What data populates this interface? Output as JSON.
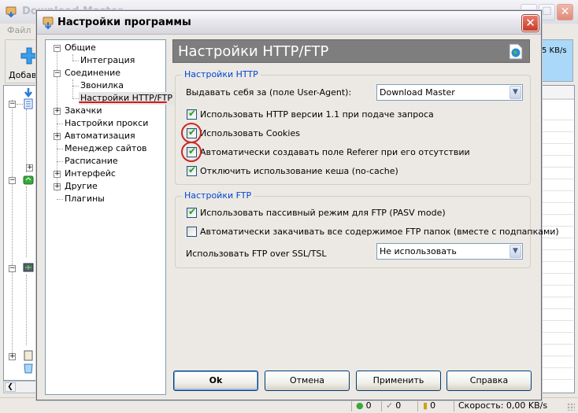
{
  "background_window": {
    "title": "Download Master",
    "menu": [
      "Файл"
    ],
    "toolbar": {
      "add_label": "Добавить"
    },
    "speed_box_text": "5 KB/s",
    "statusbar": {
      "downloading_count": "0",
      "completed_count": "0",
      "paused_count": "0",
      "speed": "Скорость: 0,00 KB/s"
    }
  },
  "dialog": {
    "title": "Настройки программы",
    "nav_tree": [
      {
        "label": "Общие",
        "level": 0,
        "expander": "-"
      },
      {
        "label": "Интеграция",
        "level": 1
      },
      {
        "label": "Соединение",
        "level": 0,
        "expander": "-"
      },
      {
        "label": "Звонилка",
        "level": 1
      },
      {
        "label": "Настройки HTTP/FTP",
        "level": 1,
        "selected": true
      },
      {
        "label": "Закачки",
        "level": 0,
        "expander": "+"
      },
      {
        "label": "Настройки прокси",
        "level": 0
      },
      {
        "label": "Автоматизация",
        "level": 0,
        "expander": "+"
      },
      {
        "label": "Менеджер сайтов",
        "level": 0
      },
      {
        "label": "Расписание",
        "level": 0
      },
      {
        "label": "Интерфейс",
        "level": 0,
        "expander": "+"
      },
      {
        "label": "Другие",
        "level": 0,
        "expander": "+"
      },
      {
        "label": "Плагины",
        "level": 0
      }
    ],
    "panel": {
      "title": "Настройки HTTP/FTP",
      "http_group": {
        "legend": "Настройки HTTP",
        "user_agent_label": "Выдавать себя за (поле User-Agent):",
        "user_agent_value": "Download Master",
        "checkboxes": [
          {
            "label": "Использовать HTTP версии 1.1 при подаче запроса",
            "checked": true
          },
          {
            "label": "Использовать Cookies",
            "checked": true
          },
          {
            "label": "Автоматически создавать поле Referer при его отсутствии",
            "checked": true
          },
          {
            "label": "Отключить использование кеша (no-cache)",
            "checked": true
          }
        ]
      },
      "ftp_group": {
        "legend": "Настройки FTP",
        "checkboxes": [
          {
            "label": "Использовать пассивный режим для FTP (PASV mode)",
            "checked": true
          },
          {
            "label": "Автоматически закачивать все содержимое FTP папок (вместе с подпапками)",
            "checked": false
          }
        ],
        "ssl_label": "Использовать FTP over SSL/TSL",
        "ssl_value": "Не использовать"
      }
    },
    "buttons": {
      "ok": "Ok",
      "cancel": "Отмена",
      "apply": "Применить",
      "help": "Справка"
    }
  },
  "colors": {
    "legend_blue": "#0046d5",
    "annotation_red": "#c82828",
    "checkmark_green": "#21a121",
    "panel_header_gray": "#7e7e7e"
  }
}
